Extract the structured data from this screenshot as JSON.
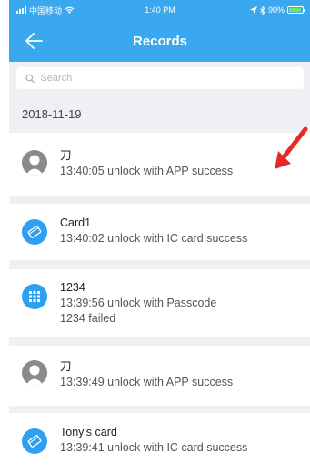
{
  "status": {
    "carrier": "中国移动",
    "time": "1:40 PM",
    "battery": "90%",
    "battery_level": 0.9
  },
  "nav": {
    "title": "Records",
    "back_icon": "arrow-left-icon"
  },
  "search": {
    "placeholder": "Search",
    "icon": "search-icon"
  },
  "date": "2018-11-19",
  "records": [
    {
      "name": "刀",
      "line1": "13:40:05 unlock with APP success",
      "line2": "",
      "icon": "user-avatar-icon"
    },
    {
      "name": "Card1",
      "line1": "13:40:02 unlock with IC card success",
      "line2": "",
      "icon": "ic-card-icon"
    },
    {
      "name": "1234",
      "line1": "13:39:56 unlock with Passcode",
      "line2": "1234 failed",
      "icon": "keypad-icon"
    },
    {
      "name": "刀",
      "line1": "13:39:49 unlock with APP success",
      "line2": "",
      "icon": "user-avatar-icon"
    },
    {
      "name": "Tony's card",
      "line1": "13:39:41 unlock with IC card success",
      "line2": "",
      "icon": "ic-card-icon"
    }
  ],
  "colors": {
    "accent": "#3aa8ef",
    "annotation": "#e52b23"
  }
}
